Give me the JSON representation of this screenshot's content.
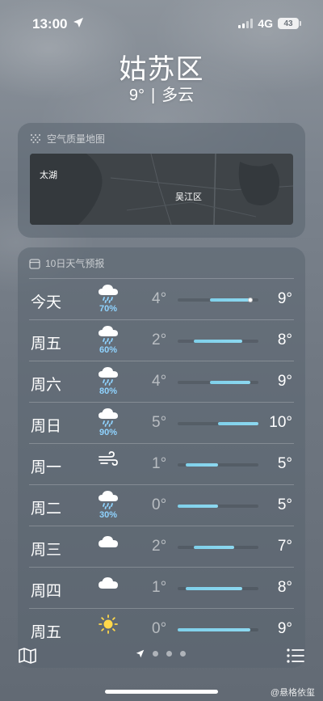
{
  "status_bar": {
    "time": "13:00",
    "network": "4G",
    "battery": "43"
  },
  "header": {
    "city": "姑苏区",
    "temperature": "9°",
    "separator": "|",
    "condition": "多云"
  },
  "air_quality": {
    "title": "空气质量地图",
    "map_labels": [
      "太湖",
      "吴江区"
    ]
  },
  "forecast": {
    "title": "10日天气预报",
    "scale": {
      "min": 0,
      "max": 10
    },
    "days": [
      {
        "day": "今天",
        "icon": "rain-cloud-icon",
        "precip": "70%",
        "low": "4°",
        "high": "9°",
        "low_val": 4,
        "high_val": 9,
        "current_val": 9
      },
      {
        "day": "周五",
        "icon": "rain-cloud-icon",
        "precip": "60%",
        "low": "2°",
        "high": "8°",
        "low_val": 2,
        "high_val": 8
      },
      {
        "day": "周六",
        "icon": "rain-cloud-icon",
        "precip": "80%",
        "low": "4°",
        "high": "9°",
        "low_val": 4,
        "high_val": 9
      },
      {
        "day": "周日",
        "icon": "rain-cloud-icon",
        "precip": "90%",
        "low": "5°",
        "high": "10°",
        "low_val": 5,
        "high_val": 10
      },
      {
        "day": "周一",
        "icon": "wind-icon",
        "precip": "",
        "low": "1°",
        "high": "5°",
        "low_val": 1,
        "high_val": 5
      },
      {
        "day": "周二",
        "icon": "rain-cloud-icon",
        "precip": "30%",
        "low": "0°",
        "high": "5°",
        "low_val": 0,
        "high_val": 5
      },
      {
        "day": "周三",
        "icon": "cloud-icon",
        "precip": "",
        "low": "2°",
        "high": "7°",
        "low_val": 2,
        "high_val": 7
      },
      {
        "day": "周四",
        "icon": "cloud-icon",
        "precip": "",
        "low": "1°",
        "high": "8°",
        "low_val": 1,
        "high_val": 8
      },
      {
        "day": "周五",
        "icon": "sun-icon",
        "precip": "",
        "low": "0°",
        "high": "9°",
        "low_val": 0,
        "high_val": 9
      }
    ]
  },
  "bottom_bar": {
    "pages": 3,
    "active_page": 0
  },
  "watermark": "@悬格依玺"
}
